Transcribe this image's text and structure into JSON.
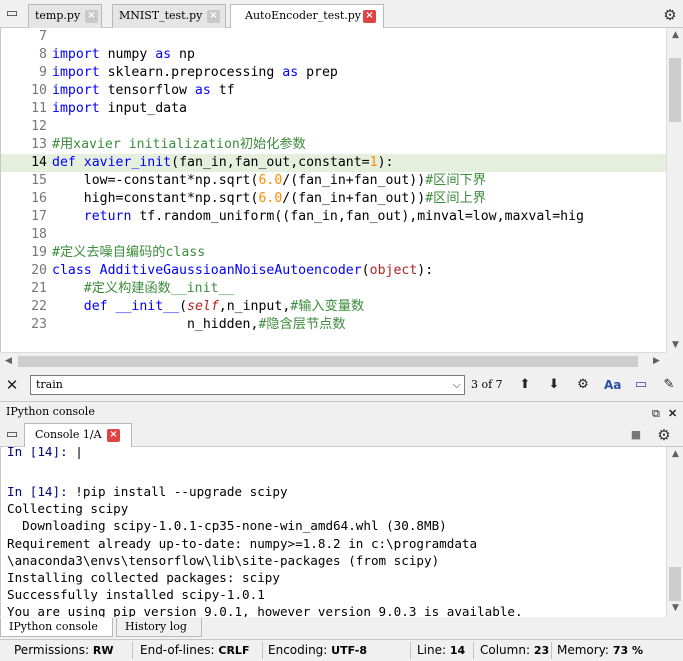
{
  "editor_tabs": [
    {
      "label": "temp.py",
      "active": false
    },
    {
      "label": "MNIST_test.py",
      "active": false
    },
    {
      "label": "AutoEncoder_test.py",
      "active": true
    }
  ],
  "code_lines": [
    {
      "n": "7",
      "parts": []
    },
    {
      "n": "8",
      "parts": [
        [
          "kw",
          "import"
        ],
        [
          "t",
          " numpy "
        ],
        [
          "kw",
          "as"
        ],
        [
          "t",
          " np"
        ]
      ]
    },
    {
      "n": "9",
      "parts": [
        [
          "kw",
          "import"
        ],
        [
          "t",
          " sklearn.preprocessing "
        ],
        [
          "kw",
          "as"
        ],
        [
          "t",
          " prep"
        ]
      ]
    },
    {
      "n": "10",
      "parts": [
        [
          "kw",
          "import"
        ],
        [
          "t",
          " tensorflow "
        ],
        [
          "kw",
          "as"
        ],
        [
          "t",
          " tf"
        ]
      ]
    },
    {
      "n": "11",
      "parts": [
        [
          "kw",
          "import"
        ],
        [
          "t",
          " input_data"
        ]
      ]
    },
    {
      "n": "12",
      "parts": []
    },
    {
      "n": "13",
      "parts": [
        [
          "cm",
          "#用xavier initialization初始化参数"
        ]
      ]
    },
    {
      "n": "14",
      "current": true,
      "parts": [
        [
          "kw",
          "def"
        ],
        [
          "t",
          " "
        ],
        [
          "fn",
          "xavier_init"
        ],
        [
          "t",
          "(fan_in,fan_out,constant="
        ],
        [
          "num",
          "1"
        ],
        [
          "t",
          "):"
        ]
      ]
    },
    {
      "n": "15",
      "parts": [
        [
          "t",
          "    low=-constant*np.sqrt("
        ],
        [
          "num",
          "6.0"
        ],
        [
          "t",
          "/(fan_in+fan_out))"
        ],
        [
          "cm",
          "#区间下界"
        ]
      ]
    },
    {
      "n": "16",
      "parts": [
        [
          "t",
          "    high=constant*np.sqrt("
        ],
        [
          "num",
          "6.0"
        ],
        [
          "t",
          "/(fan_in+fan_out))"
        ],
        [
          "cm",
          "#区间上界"
        ]
      ]
    },
    {
      "n": "17",
      "parts": [
        [
          "t",
          "    "
        ],
        [
          "kw",
          "return"
        ],
        [
          "t",
          " tf.random_uniform((fan_in,fan_out),minval=low,maxval=hig"
        ]
      ]
    },
    {
      "n": "18",
      "parts": []
    },
    {
      "n": "19",
      "parts": [
        [
          "cm",
          "#定义去噪自编码的class"
        ]
      ]
    },
    {
      "n": "20",
      "parts": [
        [
          "kw",
          "class"
        ],
        [
          "t",
          " "
        ],
        [
          "cls-name",
          "AdditiveGaussioanNoiseAutoencoder"
        ],
        [
          "t",
          "("
        ],
        [
          "obj",
          "object"
        ],
        [
          "t",
          "):"
        ]
      ]
    },
    {
      "n": "21",
      "parts": [
        [
          "t",
          "    "
        ],
        [
          "cm",
          "#定义构建函数__init__"
        ]
      ]
    },
    {
      "n": "22",
      "parts": [
        [
          "t",
          "    "
        ],
        [
          "kw",
          "def"
        ],
        [
          "t",
          " "
        ],
        [
          "fn",
          "__init__"
        ],
        [
          "t",
          "("
        ],
        [
          "slf",
          "self"
        ],
        [
          "t",
          ",n_input,"
        ],
        [
          "cm",
          "#输入变量数"
        ]
      ]
    },
    {
      "n": "23",
      "parts": [
        [
          "t",
          "                 n_hidden,"
        ],
        [
          "cm",
          "#隐含层节点数"
        ]
      ]
    }
  ],
  "find": {
    "value": "train",
    "count": "3 of 7"
  },
  "console_pane": {
    "title": "IPython console",
    "tab_label": "Console 1/A"
  },
  "console_lines": [
    {
      "prompt": "In [14]: ",
      "text": "|"
    },
    {
      "prompt": "",
      "text": ""
    },
    {
      "prompt": "In [14]: ",
      "text": "!pip install --upgrade scipy"
    },
    {
      "prompt": "",
      "text": "Collecting scipy"
    },
    {
      "prompt": "",
      "text": "  Downloading scipy-1.0.1-cp35-none-win_amd64.whl (30.8MB)"
    },
    {
      "prompt": "",
      "text": "Requirement already up-to-date: numpy>=1.8.2 in c:\\programdata"
    },
    {
      "prompt": "",
      "text": "\\anaconda3\\envs\\tensorflow\\lib\\site-packages (from scipy)"
    },
    {
      "prompt": "",
      "text": "Installing collected packages: scipy"
    },
    {
      "prompt": "",
      "text": "Successfully installed scipy-1.0.1"
    },
    {
      "prompt": "",
      "text": "You are using pip version 9.0.1, however version 9.0.3 is available."
    }
  ],
  "bottom_tabs": [
    "IPython console",
    "History log"
  ],
  "status": {
    "permissions_label": "Permissions:",
    "permissions": "RW",
    "eol_label": "End-of-lines:",
    "eol": "CRLF",
    "encoding_label": "Encoding:",
    "encoding": "UTF-8",
    "line_label": "Line:",
    "line": "14",
    "column_label": "Column:",
    "column": "23",
    "memory_label": "Memory:",
    "memory": "73 %"
  },
  "colors": {
    "keyword": "#0000ff",
    "comment": "#3c8d3c",
    "number": "#ff8c00",
    "self": "#b22222",
    "current_line": "#e4f0dd",
    "close_active": "#e04343"
  }
}
